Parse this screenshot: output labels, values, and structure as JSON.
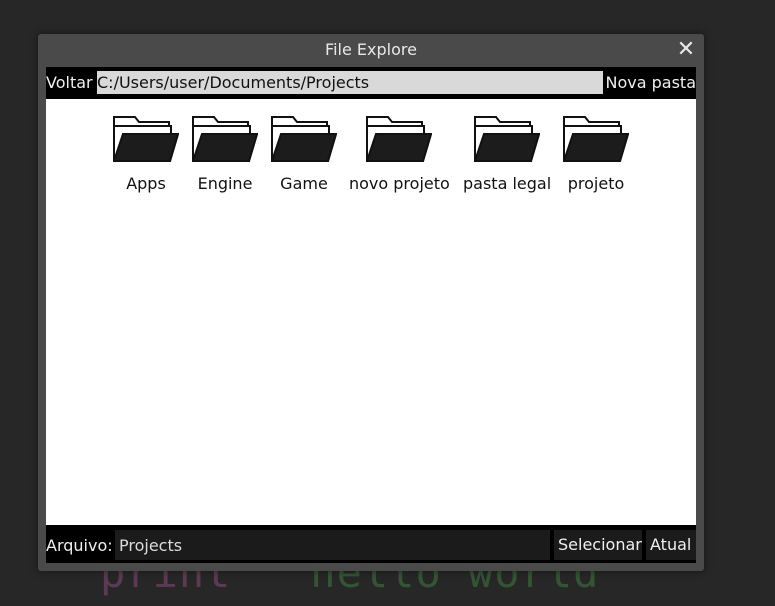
{
  "background_code": {
    "keyword": "print",
    "string": "\"hello world\""
  },
  "window": {
    "title": "File Explore",
    "close_icon": "close-icon"
  },
  "toolbar": {
    "back_label": "Voltar",
    "path_value": "C:/Users/user/Documents/Projects",
    "new_folder_label": "Nova pasta"
  },
  "folders": [
    {
      "name": "Apps",
      "icon": "folder-icon"
    },
    {
      "name": "Engine",
      "icon": "folder-icon"
    },
    {
      "name": "Game",
      "icon": "folder-icon"
    },
    {
      "name": "novo projeto",
      "icon": "folder-icon"
    },
    {
      "name": "pasta legal",
      "icon": "folder-icon"
    },
    {
      "name": "projeto",
      "icon": "folder-icon"
    }
  ],
  "footer": {
    "file_label": "Arquivo:",
    "file_value": "Projects",
    "select_label": "Selecionar",
    "current_label": "Atual"
  },
  "colors": {
    "desktop_bg": "#272727",
    "window_bg": "#4a4a4a",
    "content_bg": "#ffffff",
    "bar_bg": "#000000",
    "path_field_bg": "#d9d9d9"
  }
}
